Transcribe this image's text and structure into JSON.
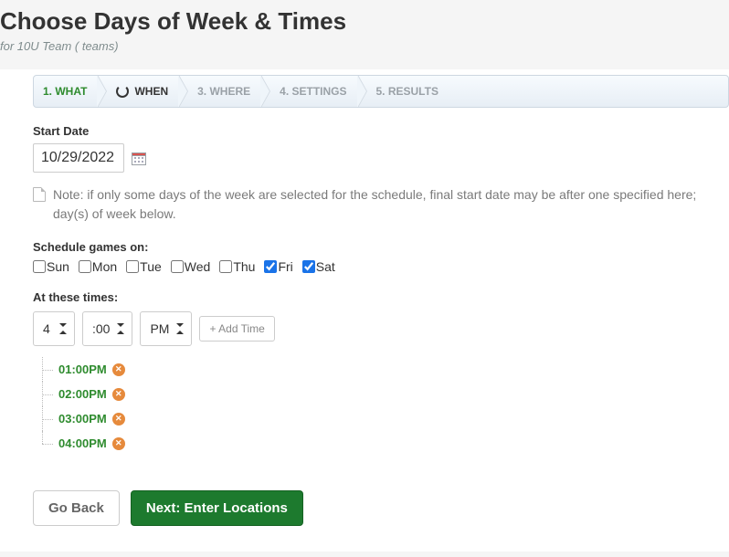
{
  "header": {
    "title": "Choose Days of Week & Times",
    "subtitle": "for 10U Team ( teams)"
  },
  "steps": [
    {
      "label": "1. WHAT",
      "state": "active"
    },
    {
      "label": "WHEN",
      "state": "current"
    },
    {
      "label": "3. WHERE",
      "state": ""
    },
    {
      "label": "4. SETTINGS",
      "state": ""
    },
    {
      "label": "5. RESULTS",
      "state": ""
    }
  ],
  "start_date": {
    "label": "Start Date",
    "value": "10/29/2022"
  },
  "note_text": "Note: if only some days of the week are selected for the schedule, final start date may be after one specified here; day(s) of week below.",
  "schedule_label": "Schedule games on:",
  "days": [
    {
      "label": "Sun",
      "checked": false
    },
    {
      "label": "Mon",
      "checked": false
    },
    {
      "label": "Tue",
      "checked": false
    },
    {
      "label": "Wed",
      "checked": false
    },
    {
      "label": "Thu",
      "checked": false
    },
    {
      "label": "Fri",
      "checked": true
    },
    {
      "label": "Sat",
      "checked": true
    }
  ],
  "times_label": "At these times:",
  "time_picker": {
    "hour": "4",
    "minute": ":00",
    "ampm": "PM",
    "add_label": "+ Add Time"
  },
  "scheduled_times": [
    "01:00PM",
    "02:00PM",
    "03:00PM",
    "04:00PM"
  ],
  "buttons": {
    "back": "Go Back",
    "next": "Next: Enter Locations"
  }
}
